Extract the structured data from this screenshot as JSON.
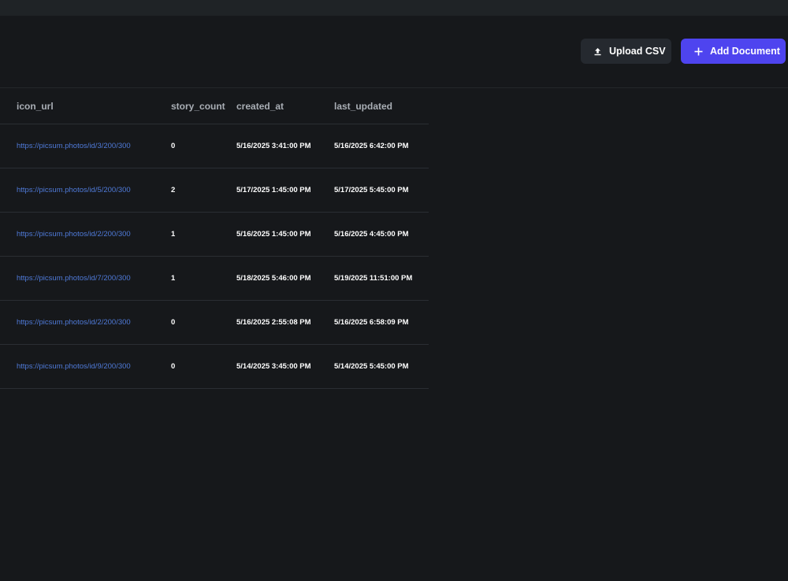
{
  "toolbar": {
    "upload_label": "Upload CSV",
    "add_label": "Add Document",
    "upload_icon": "upload-icon",
    "add_icon": "plus-icon",
    "primary_color": "#4e44ef",
    "secondary_color": "#25292f"
  },
  "table": {
    "columns": [
      "icon_url",
      "story_count",
      "created_at",
      "last_updated"
    ],
    "rows": [
      {
        "icon_url": "https://picsum.photos/id/3/200/300",
        "story_count": "0",
        "created_at": "5/16/2025 3:41:00 PM",
        "last_updated": "5/16/2025 6:42:00 PM"
      },
      {
        "icon_url": "https://picsum.photos/id/5/200/300",
        "story_count": "2",
        "created_at": "5/17/2025 1:45:00 PM",
        "last_updated": "5/17/2025 5:45:00 PM"
      },
      {
        "icon_url": "https://picsum.photos/id/2/200/300",
        "story_count": "1",
        "created_at": "5/16/2025 1:45:00 PM",
        "last_updated": "5/16/2025 4:45:00 PM"
      },
      {
        "icon_url": "https://picsum.photos/id/7/200/300",
        "story_count": "1",
        "created_at": "5/18/2025 5:46:00 PM",
        "last_updated": "5/19/2025 11:51:00 PM"
      },
      {
        "icon_url": "https://picsum.photos/id/2/200/300",
        "story_count": "0",
        "created_at": "5/16/2025 2:55:08 PM",
        "last_updated": "5/16/2025 6:58:09 PM"
      },
      {
        "icon_url": "https://picsum.photos/id/9/200/300",
        "story_count": "0",
        "created_at": "5/14/2025 3:45:00 PM",
        "last_updated": "5/14/2025 5:45:00 PM"
      }
    ]
  }
}
